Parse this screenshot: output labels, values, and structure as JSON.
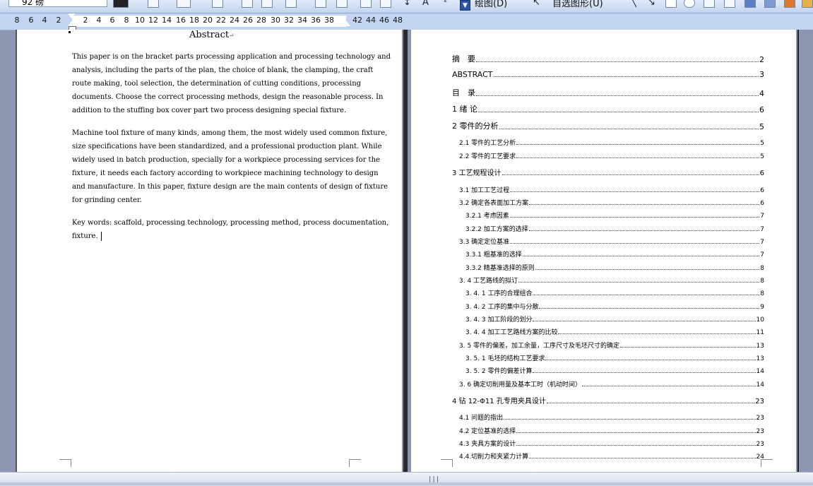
{
  "toolbar": {
    "zoom_value": "92 磅",
    "draw_menu": "绘图(D)",
    "autoshapes_menu": "自选图形(U)"
  },
  "ruler": {
    "numbers": [
      "8",
      "6",
      "4",
      "2",
      "2",
      "4",
      "6",
      "8",
      "10",
      "12",
      "14",
      "16",
      "18",
      "20",
      "22",
      "24",
      "26",
      "28",
      "30",
      "32",
      "34",
      "36",
      "38",
      "42",
      "44",
      "46",
      "48"
    ]
  },
  "left_page": {
    "title": "Abstract",
    "paragraphs": [
      {
        "lines": [
          "This paper is on the bracket parts processing application and processing technology and",
          "analysis, including the parts of the plan, the choice of blank, the clamping, the craft",
          "route making, tool selection, the determination of cutting conditions, processing",
          "documents. Choose the correct processing methods, design the reasonable process. In",
          "addition to the stuffing box cover part two process designing special fixture."
        ]
      },
      {
        "lines": [
          "Machine tool fixture of many kinds, among them, the most widely used common fixture,",
          "size specifications have been standardized, and a professional production plant. While",
          "widely used in batch production, specially for a workpiece processing services for the",
          "fixture, it needs each factory according to workpiece machining technology to design",
          "and manufacture. In this paper, fixture design are the main contents of design of fixture",
          "for grinding center."
        ]
      },
      {
        "lines": [
          "Key words: scaffold, processing technology, processing method, process documentation,",
          "fixture."
        ]
      }
    ]
  },
  "toc": [
    {
      "label": "摘　要",
      "page": "2"
    },
    {
      "label": "ABSTRACT",
      "page": "3"
    },
    {
      "label": "目　录",
      "page": "4"
    },
    {
      "label": "1  绪  论",
      "page": "6"
    },
    {
      "label": "2  零件的分析",
      "page": "5"
    },
    {
      "label": "2.1 零件的工艺分析",
      "page": "5"
    },
    {
      "label": "2.2 零件的工艺要求",
      "page": "5"
    },
    {
      "label": "3  工艺规程设计",
      "page": "6"
    },
    {
      "label": "3.1 加工工艺过程",
      "page": "6"
    },
    {
      "label": "3.2 确定各表面加工方案",
      "page": "6"
    },
    {
      "label": "3.2.1  考虑因素",
      "page": "7"
    },
    {
      "label": "3.2.2  加工方案的选择",
      "page": "7"
    },
    {
      "label": "3.3  确定定位基准",
      "page": "7"
    },
    {
      "label": "3.3.1 粗基准的选择",
      "page": "7"
    },
    {
      "label": "3.3.2 精基准选择的原则",
      "page": "8"
    },
    {
      "label": "3. 4 工艺路线的拟订",
      "page": "8"
    },
    {
      "label": "3. 4. 1 工序的合理组合",
      "page": "8"
    },
    {
      "label": "3. 4. 2 工序的集中与分散",
      "page": "9"
    },
    {
      "label": "3. 4. 3 加工阶段的划分",
      "page": "10"
    },
    {
      "label": "3. 4. 4 加工工艺路线方案的比较",
      "page": "11"
    },
    {
      "label": "3. 5 零件的偏差，加工余量，工序尺寸及毛坯尺寸的确定",
      "page": "13"
    },
    {
      "label": "3. 5. 1 毛坯的结构工艺要求",
      "page": "13"
    },
    {
      "label": "3. 5. 2 零件的偏差计算",
      "page": "14"
    },
    {
      "label": "3. 6 确定切削用量及基本工时（机动时间）",
      "page": "14"
    },
    {
      "label": "4  钻 12-Φ11 孔专用夹具设计",
      "page": "23"
    },
    {
      "label": "4.1 问题的指出",
      "page": "23"
    },
    {
      "label": "4.2 定位基准的选择",
      "page": "23"
    },
    {
      "label": "4.3 夹具方案的设计",
      "page": "23"
    },
    {
      "label": "4.4.切削力和夹紧力计算",
      "page": "24"
    }
  ]
}
